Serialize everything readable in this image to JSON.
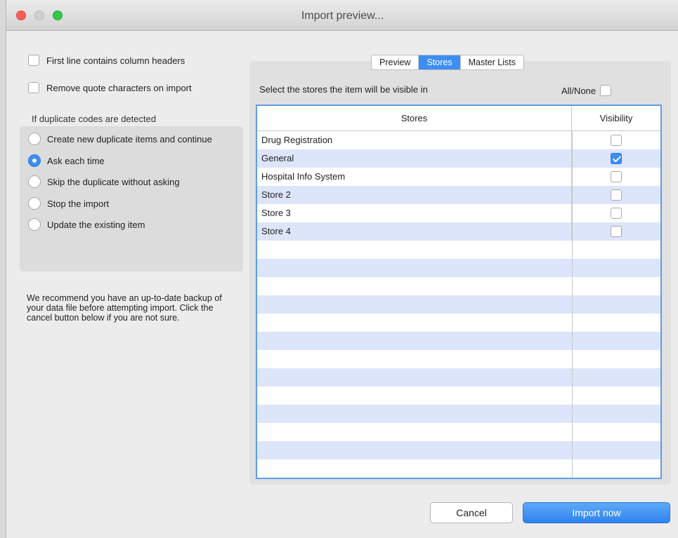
{
  "window": {
    "title": "Import preview..."
  },
  "options": {
    "first_line_headers": {
      "label": "First line contains column headers",
      "checked": false
    },
    "remove_quotes": {
      "label": "Remove quote characters on import",
      "checked": false
    }
  },
  "duplicates": {
    "header": "If duplicate codes are detected",
    "choices": [
      {
        "label": "Create new duplicate items and continue",
        "selected": false
      },
      {
        "label": "Ask each time",
        "selected": true
      },
      {
        "label": "Skip the duplicate without asking",
        "selected": false
      },
      {
        "label": "Stop the import",
        "selected": false
      },
      {
        "label": "Update the existing item",
        "selected": false
      }
    ]
  },
  "warning": "We recommend you have an up-to-date backup of your data file before attempting import. Click the cancel button below if you are not sure.",
  "tabs": [
    {
      "label": "Preview",
      "active": false
    },
    {
      "label": "Stores",
      "active": true
    },
    {
      "label": "Master Lists",
      "active": false
    }
  ],
  "stores_panel": {
    "instruction": "Select the stores the item will be visible in",
    "all_none_label": "All/None",
    "columns": {
      "stores": "Stores",
      "visibility": "Visibility"
    },
    "rows": [
      {
        "name": "Drug Registration",
        "visible": false
      },
      {
        "name": "General",
        "visible": true
      },
      {
        "name": "Hospital Info System",
        "visible": false
      },
      {
        "name": "Store 2",
        "visible": false
      },
      {
        "name": "Store 3",
        "visible": false
      },
      {
        "name": "Store 4",
        "visible": false
      }
    ]
  },
  "buttons": {
    "cancel": "Cancel",
    "import": "Import now"
  },
  "colors": {
    "accent": "#3d8ef3",
    "row_stripe": "#dde5fb",
    "close": "#fc5f57",
    "maximize": "#34c84a"
  }
}
